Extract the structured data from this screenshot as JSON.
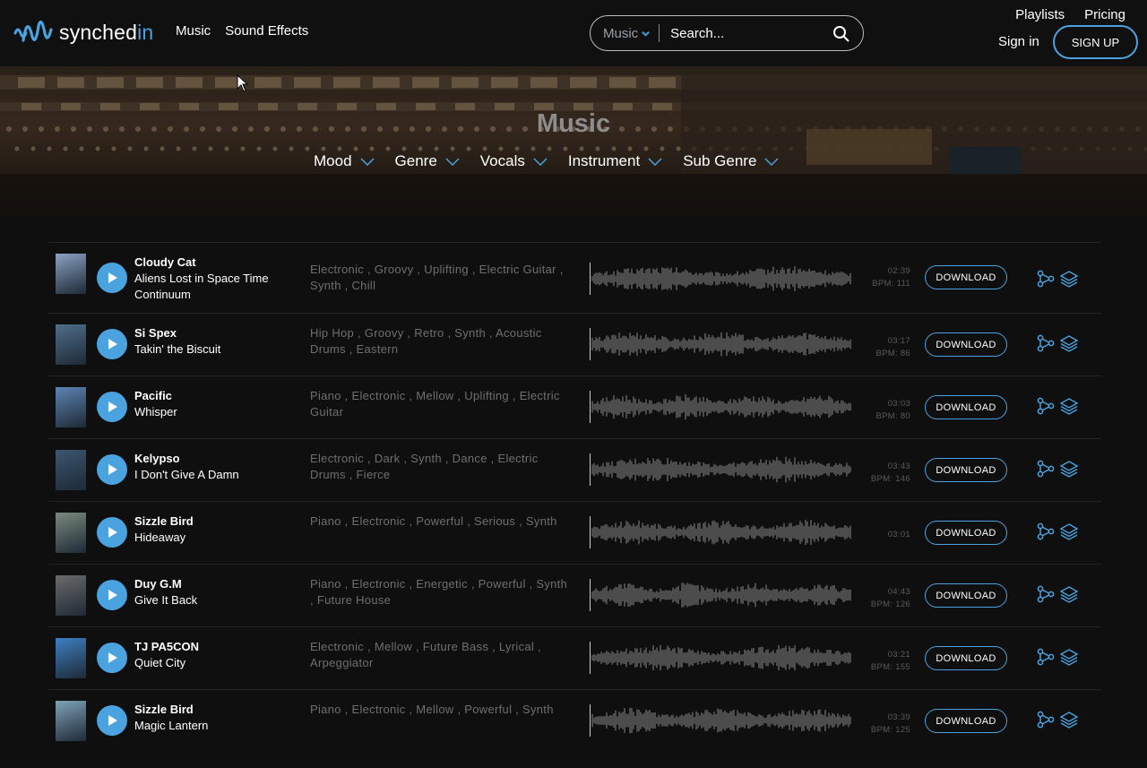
{
  "header": {
    "logo_text_main": "synched",
    "logo_text_accent": "in",
    "nav": [
      "Music",
      "Sound Effects"
    ],
    "search_category": "Music",
    "search_placeholder": "Search...",
    "playlists": "Playlists",
    "pricing": "Pricing",
    "sign_in": "Sign in",
    "sign_up": "SIGN UP"
  },
  "hero": {
    "title": "Music",
    "filters": [
      "Mood",
      "Genre",
      "Vocals",
      "Instrument",
      "Sub Genre"
    ]
  },
  "colors": {
    "accent": "#4aa3df",
    "background": "#0f0f0f",
    "tag_text": "#6f6f6f"
  },
  "download_label": "DOWNLOAD",
  "tracks": [
    {
      "artist": "Cloudy Cat",
      "title": "Aliens Lost in Space Time Continuum",
      "tags": "Electronic , Groovy , Uplifting , Electric Guitar , Synth , Chill",
      "duration": "02:39",
      "bpm": "BPM: 111",
      "thumb": "#8aa2c2"
    },
    {
      "artist": "Si Spex",
      "title": "Takin' the Biscuit",
      "tags": "Hip Hop , Groovy , Retro , Synth , Acoustic Drums , Eastern",
      "duration": "03:17",
      "bpm": "BPM: 86",
      "thumb": "#4f6e8a"
    },
    {
      "artist": "Pacific",
      "title": "Whisper",
      "tags": "Piano , Electronic , Mellow , Uplifting , Electric Guitar",
      "duration": "03:03",
      "bpm": "BPM: 80",
      "thumb": "#5d84b4"
    },
    {
      "artist": "Kelypso",
      "title": "I Don't Give A Damn",
      "tags": "Electronic , Dark , Synth , Dance , Electric Drums , Fierce",
      "duration": "03:43",
      "bpm": "BPM: 146",
      "thumb": "#3c5670"
    },
    {
      "artist": "Sizzle Bird",
      "title": "Hideaway",
      "tags": "Piano , Electronic , Powerful , Serious , Synth",
      "duration": "03:01",
      "bpm": "",
      "thumb": "#7a8a7e"
    },
    {
      "artist": "Duy G.M",
      "title": "Give It Back",
      "tags": "Piano , Electronic , Energetic , Powerful , Synth , Future House",
      "duration": "04:43",
      "bpm": "BPM: 126",
      "thumb": "#6b6b6b"
    },
    {
      "artist": "TJ PA5CON",
      "title": "Quiet City",
      "tags": "Electronic , Mellow , Future Bass , Lyrical , Arpeggiator",
      "duration": "03:21",
      "bpm": "BPM: 155",
      "thumb": "#3e7fc4"
    },
    {
      "artist": "Sizzle Bird",
      "title": "Magic Lantern",
      "tags": "Piano , Electronic , Mellow , Powerful , Synth",
      "duration": "03:39",
      "bpm": "BPM: 125",
      "thumb": "#7fa3b8"
    }
  ]
}
